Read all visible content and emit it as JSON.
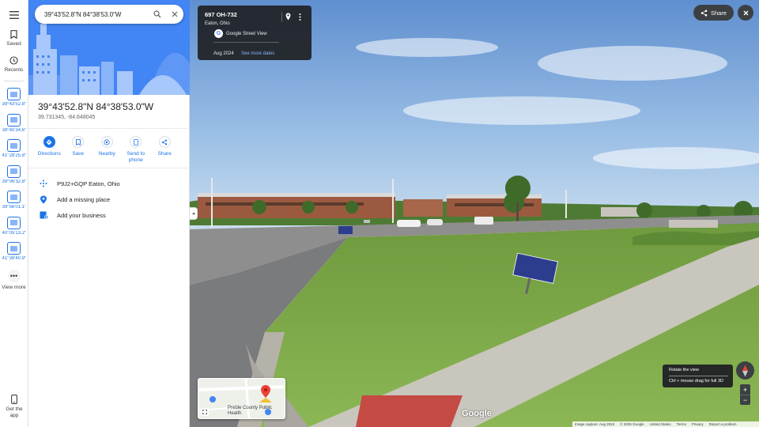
{
  "rail": {
    "saved_label": "Saved",
    "recents_label": "Recents",
    "recent_items": [
      {
        "label": "39°43'52.8\"N..."
      },
      {
        "label": "39°40'34.6\"N..."
      },
      {
        "label": "41°28'25.8\"N..."
      },
      {
        "label": "39°06'32.8\"N..."
      },
      {
        "label": "39°56'01.1\"N..."
      },
      {
        "label": "40°05'13.2\"N..."
      },
      {
        "label": "41°39'40.9\"N..."
      }
    ],
    "view_more_label": "View more",
    "get_app_label": "Get the app"
  },
  "search": {
    "value": "39°43'52.8\"N 84°38'53.0\"W"
  },
  "place": {
    "title": "39°43'52.8\"N 84°38'53.0\"W",
    "coords": "39.731345, -84.648045"
  },
  "actions": [
    {
      "label": "Directions"
    },
    {
      "label": "Save"
    },
    {
      "label": "Nearby"
    },
    {
      "label": "Send to phone"
    },
    {
      "label": "Share"
    }
  ],
  "info": {
    "plus_code": "P9J2+GQP Eaton, Ohio",
    "add_place": "Add a missing place",
    "add_business": "Add your business"
  },
  "street_card": {
    "title": "697 OH-732",
    "subtitle": "Eaton, Ohio",
    "source": "Google Street View",
    "date": "Aug 2024",
    "more_dates": "See more dates"
  },
  "top_controls": {
    "share_label": "Share"
  },
  "minimap": {
    "label": "Preble County Public Health"
  },
  "rotate_tip": {
    "title": "Rotate the view",
    "hint": "Ctrl + mouse drag for full 3D"
  },
  "footer": {
    "capture": "Image capture: Aug 2024",
    "copyright": "© 2025 Google",
    "country": "United States",
    "terms": "Terms",
    "privacy": "Privacy",
    "report": "Report a problem"
  },
  "logo_text": "Google",
  "colors": {
    "accent": "#1a73e8",
    "hero": "#4285f4",
    "sky": "#7fa8d8",
    "grass": "#7ea94c",
    "card_bg": "#202124"
  }
}
